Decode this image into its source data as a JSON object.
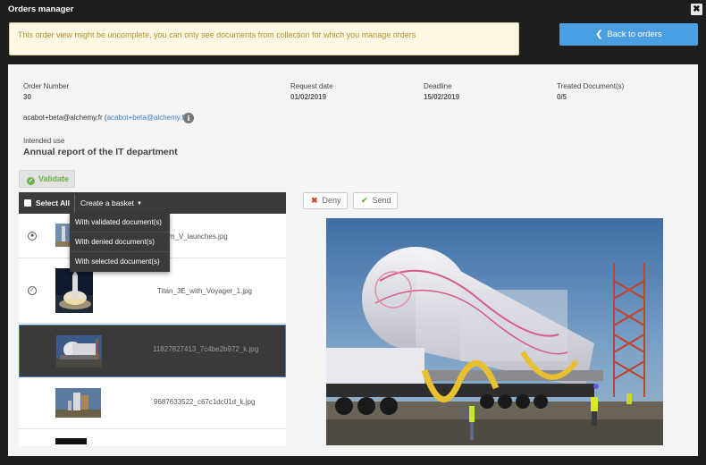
{
  "window": {
    "title": "Orders manager",
    "close_glyph": "✖"
  },
  "warning": {
    "text": "This order view might be uncomplete, you can only see documents from collection for which you manage orders"
  },
  "back_button": {
    "chevron": "❮",
    "label": "Back to orders"
  },
  "order": {
    "number_label": "Order Number",
    "number_value": "30",
    "request_label": "Request date",
    "request_value": "01/02/2019",
    "deadline_label": "Deadline",
    "deadline_value": "15/02/2019",
    "treated_label": "Treated Document(s)",
    "treated_value": "0/5",
    "email_text": "acabot+beta@alchemy.fr",
    "email_link": "acabot+beta@alchemy.fr",
    "info_icon": "i",
    "intended_use_label": "Intended use",
    "intended_use_value": "Annual report of the IT department"
  },
  "validate_button": {
    "label": "Validate",
    "icon": "check-circle-icon"
  },
  "list_toolbar": {
    "select_all": "Select All",
    "create_basket": "Create a basket",
    "caret": "▼"
  },
  "basket_menu": [
    "With validated document(s)",
    "With denied document(s)",
    "With selected document(s)"
  ],
  "documents": [
    {
      "filename": "Saturn_V_launches.jpg",
      "status": "denied"
    },
    {
      "filename": "Titan_3E_with_Voyager_1.jpg",
      "status": "validated"
    },
    {
      "filename": "11827827413_7c4be2b972_k.jpg",
      "status": "selected"
    },
    {
      "filename": "9687633522_c67c1dc01d_k.jpg",
      "status": "none"
    },
    {
      "filename": "",
      "status": "none"
    }
  ],
  "actions": {
    "deny_label": "Deny",
    "deny_glyph": "✖",
    "send_label": "Send",
    "send_glyph": "✔"
  },
  "colors": {
    "accent": "#4a9ee2",
    "validate": "#6ab04c",
    "deny": "#d9423a",
    "warning_bg": "#fcf8e3",
    "warning_text": "#b5912f"
  }
}
